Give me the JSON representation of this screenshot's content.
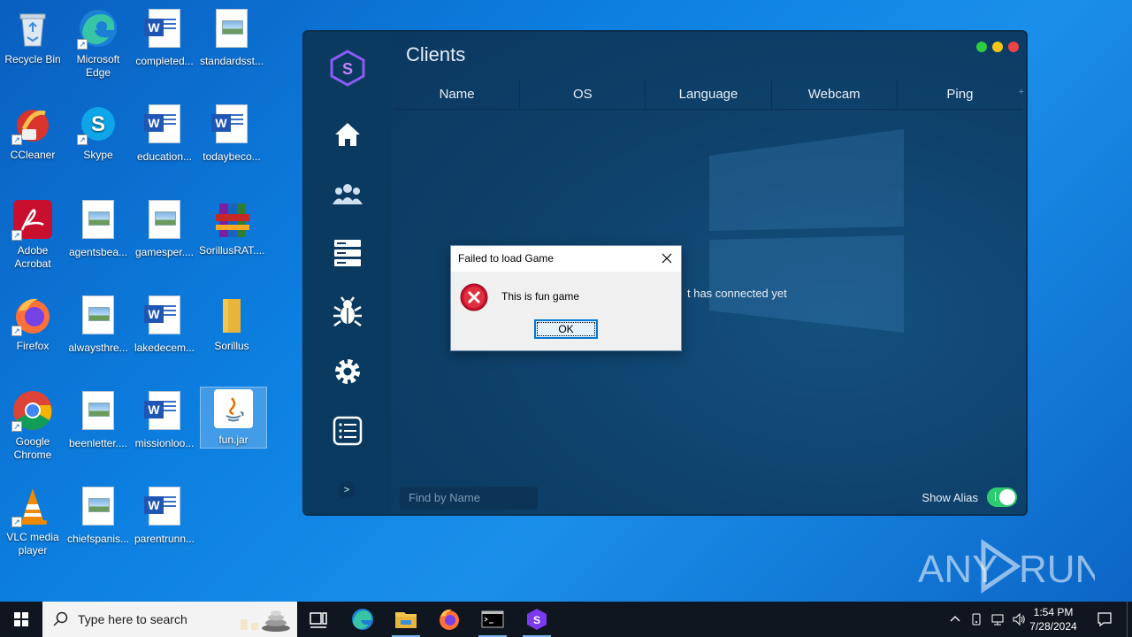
{
  "desktop": {
    "icons": [
      {
        "label": "Recycle Bin"
      },
      {
        "label": "Microsoft Edge"
      },
      {
        "label": "completed..."
      },
      {
        "label": "standardsst..."
      },
      {
        "label": "CCleaner"
      },
      {
        "label": "Skype"
      },
      {
        "label": "education..."
      },
      {
        "label": "todaybeco..."
      },
      {
        "label": "Adobe Acrobat"
      },
      {
        "label": "agentsbea..."
      },
      {
        "label": "gamesper...."
      },
      {
        "label": "SorillusRAT...."
      },
      {
        "label": "Firefox"
      },
      {
        "label": "alwaysthre..."
      },
      {
        "label": "lakedecem..."
      },
      {
        "label": "Sorillus"
      },
      {
        "label": "Google Chrome"
      },
      {
        "label": "beenletter...."
      },
      {
        "label": "missionloo..."
      },
      {
        "label": "fun.jar"
      },
      {
        "label": "VLC media player"
      },
      {
        "label": "chiefspanis..."
      },
      {
        "label": "parentrunn..."
      }
    ]
  },
  "app": {
    "title": "Clients",
    "columns": [
      "Name",
      "OS",
      "Language",
      "Webcam",
      "Ping"
    ],
    "empty_message": "t has connected yet",
    "search_placeholder": "Find by Name",
    "show_alias_label": "Show Alias",
    "show_alias_on": true,
    "expander_label": ">",
    "add_column": "+",
    "accent_colors": {
      "green": "#2ecc40",
      "yellow": "#f5c518",
      "red": "#ee4444",
      "toggle": "#2ecc71"
    }
  },
  "dialog": {
    "title": "Failed to load Game",
    "message": "This is fun game",
    "ok_label": "OK",
    "icon": "error-icon"
  },
  "watermark": {
    "text": "ANY RUN"
  },
  "taskbar": {
    "search_placeholder": "Type here to search",
    "time": "1:54 PM",
    "date": "7/28/2024"
  }
}
